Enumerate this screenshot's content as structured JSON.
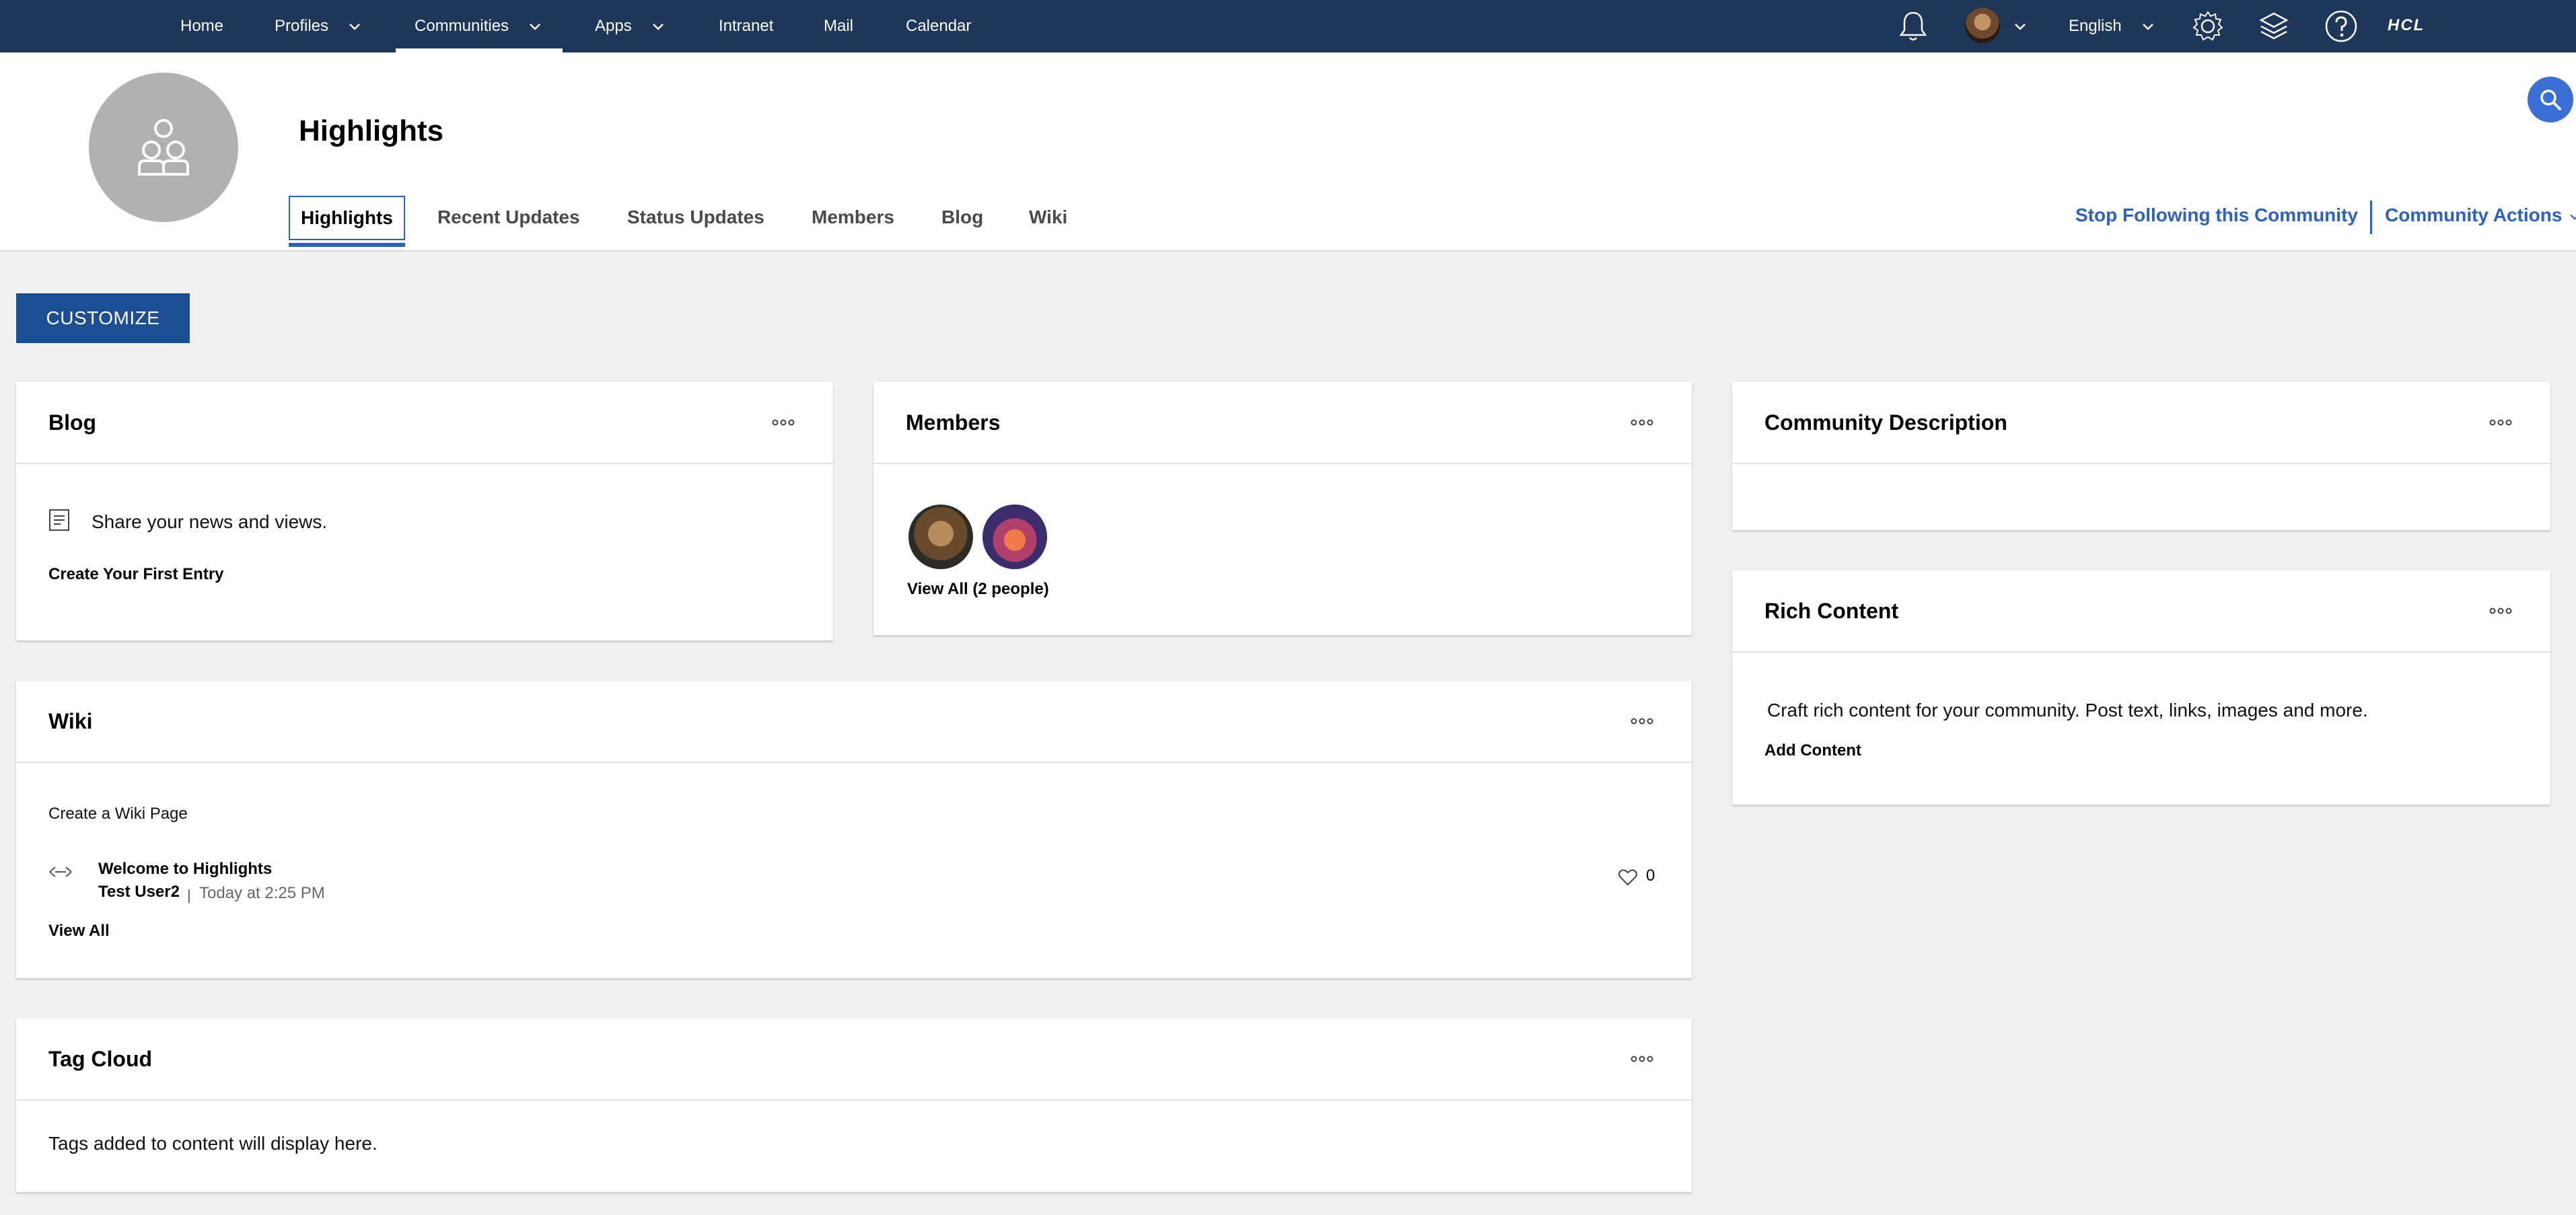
{
  "topnav": {
    "items": [
      {
        "label": "Home"
      },
      {
        "label": "Profiles"
      },
      {
        "label": "Communities"
      },
      {
        "label": "Apps"
      },
      {
        "label": "Intranet"
      },
      {
        "label": "Mail"
      },
      {
        "label": "Calendar"
      }
    ],
    "language": "English",
    "brand": "HCL",
    "icons": [
      "bell-icon",
      "user-avatar",
      "chevron-down-icon",
      "settings-icon",
      "layers-icon",
      "help-icon"
    ]
  },
  "header": {
    "title": "Highlights",
    "tabs": [
      {
        "label": "Highlights"
      },
      {
        "label": "Recent Updates"
      },
      {
        "label": "Status Updates"
      },
      {
        "label": "Members"
      },
      {
        "label": "Blog"
      },
      {
        "label": "Wiki"
      }
    ],
    "stop_following": "Stop Following this Community",
    "community_actions": "Community Actions"
  },
  "customize_label": "CUSTOMIZE",
  "blog": {
    "title": "Blog",
    "description": "Share your news and views.",
    "create_link": "Create Your First Entry"
  },
  "members": {
    "title": "Members",
    "view_all": "View All (2 people)"
  },
  "community_description": {
    "title": "Community Description"
  },
  "rich_content": {
    "title": "Rich Content",
    "description": "Craft rich content for your community. Post text, links, images and more.",
    "add_link": "Add Content"
  },
  "wiki": {
    "title": "Wiki",
    "create_link": "Create a Wiki Page",
    "page": {
      "title": "Welcome to Highlights",
      "author": "Test User2",
      "separator": "|",
      "time": "Today at 2:25 PM",
      "likes": "0"
    },
    "view_all": "View All"
  },
  "tag_cloud": {
    "title": "Tag Cloud",
    "empty_text": "Tags added to content will display here."
  },
  "colors": {
    "nav_bg": "#1e3657",
    "accent": "#2b62c1",
    "button_bg": "#1c4e93",
    "page_bg": "#f0f0f0"
  }
}
